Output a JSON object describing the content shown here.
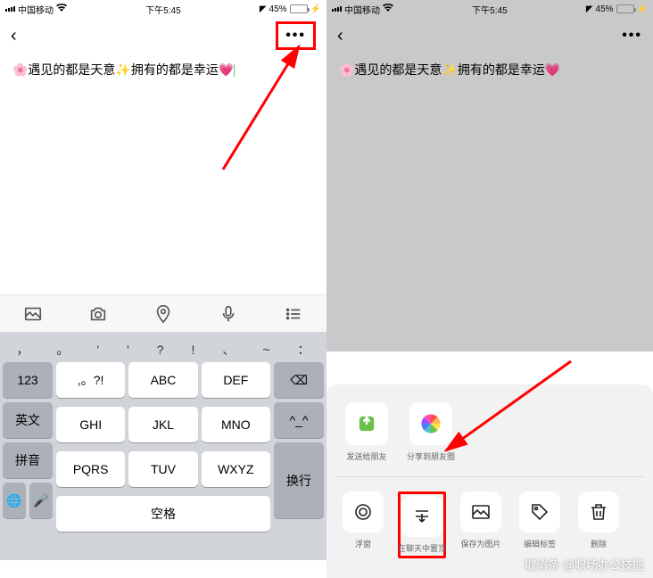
{
  "status": {
    "carrier": "中国移动",
    "time": "下午5:45",
    "battery": "45%",
    "location_icon": "✈"
  },
  "content": {
    "text": "🌸遇见的都是天意✨拥有的都是幸运💗"
  },
  "keyboard": {
    "symbols": [
      "，",
      "。",
      "'",
      "'",
      "?",
      "!",
      "、",
      "~",
      "："
    ],
    "row1": {
      "side": "123",
      "k": [
        ",。?!",
        "ABC",
        "DEF"
      ],
      "del": "⌫"
    },
    "row2": {
      "side": "英文",
      "k": [
        "GHI",
        "JKL",
        "MNO"
      ],
      "cand": "^_^"
    },
    "row3": {
      "side": "拼音",
      "k": [
        "PQRS",
        "TUV",
        "WXYZ"
      ],
      "enter": "换行"
    },
    "row4": {
      "globe": "🌐",
      "mic": "🎤",
      "space": "空格"
    }
  },
  "toolbar": [
    "image",
    "camera",
    "location",
    "mic",
    "list"
  ],
  "sheet": {
    "row1": [
      {
        "key": "send-friend",
        "label": "发送给朋友",
        "icon": "wechat"
      },
      {
        "key": "share-moments",
        "label": "分享到朋友圈",
        "icon": "moments"
      }
    ],
    "row2": [
      {
        "key": "float",
        "label": "浮窗",
        "icon": "circle"
      },
      {
        "key": "pin-chat",
        "label": "在聊天中置顶",
        "icon": "pin"
      },
      {
        "key": "save-img",
        "label": "保存为图片",
        "icon": "image"
      },
      {
        "key": "edit-tag",
        "label": "编辑标签",
        "icon": "tag"
      },
      {
        "key": "delete",
        "label": "删除",
        "icon": "trash"
      }
    ]
  },
  "watermark": "取消条 @职场办公技能"
}
